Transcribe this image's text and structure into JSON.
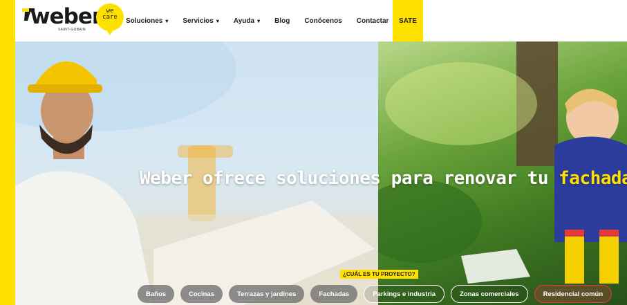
{
  "brand": {
    "logo_text": "weber",
    "logo_subtext": "SAINT-GOBAIN",
    "logo_accent": "#ffe100",
    "wecare_text": "we\ncare"
  },
  "nav": {
    "items": [
      {
        "label": "Soluciones",
        "has_dropdown": true
      },
      {
        "label": "Servicios",
        "has_dropdown": true
      },
      {
        "label": "Ayuda",
        "has_dropdown": true
      },
      {
        "label": "Blog",
        "has_dropdown": false
      },
      {
        "label": "Conócenos",
        "has_dropdown": false
      },
      {
        "label": "Contactar",
        "has_dropdown": false
      }
    ],
    "highlight_label": "SATE",
    "dropdown_icon": "chevron-down-icon"
  },
  "hero": {
    "tagline_main": "Weber ofrece soluciones para renovar tu",
    "tagline_highlight": "fachada",
    "question": "¿CUÁL ES TU PROYECTO?",
    "chips": [
      {
        "label": "Baños",
        "style": "filled"
      },
      {
        "label": "Cocinas",
        "style": "filled"
      },
      {
        "label": "Terrazas y jardines",
        "style": "filled"
      },
      {
        "label": "Fachadas",
        "style": "filled"
      },
      {
        "label": "Parkings e industria",
        "style": "outline"
      },
      {
        "label": "Zonas comerciales",
        "style": "outline"
      },
      {
        "label": "Residencial común",
        "style": "selected"
      }
    ]
  },
  "colors": {
    "accent_yellow": "#ffe100",
    "selected_chip_border": "#e23b3b"
  }
}
